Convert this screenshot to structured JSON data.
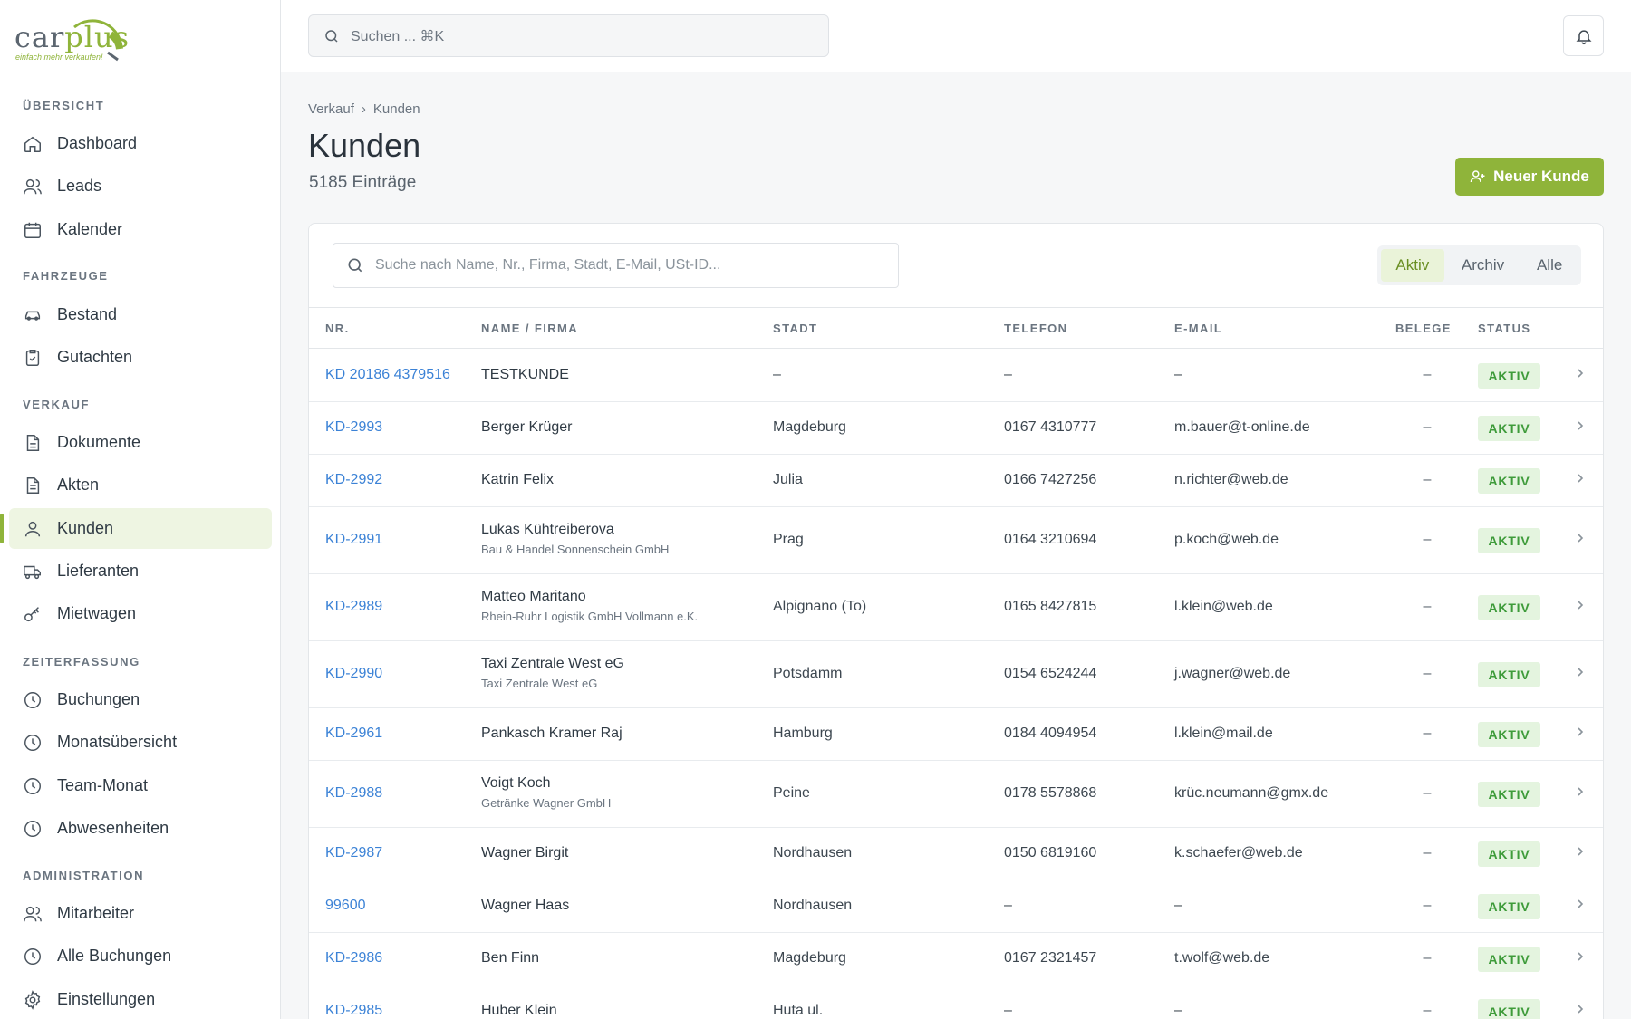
{
  "brand": {
    "name_a": "car",
    "name_b": "plus",
    "tagline": "einfach mehr verkaufen!"
  },
  "topbar": {
    "search_placeholder": "Suchen ... ⌘K"
  },
  "sidebar": {
    "sections": {
      "overview": "ÜBERSICHT",
      "vehicles": "FAHRZEUGE",
      "sales": "VERKAUF",
      "time": "ZEITERFASSUNG",
      "admin": "ADMINISTRATION"
    },
    "items": {
      "dashboard": "Dashboard",
      "leads": "Leads",
      "kalender": "Kalender",
      "bestand": "Bestand",
      "gutachten": "Gutachten",
      "dokumente": "Dokumente",
      "akten": "Akten",
      "kunden": "Kunden",
      "lieferanten": "Lieferanten",
      "mietwagen": "Mietwagen",
      "buchungen": "Buchungen",
      "monatsuebersicht": "Monatsübersicht",
      "teammonat": "Team-Monat",
      "abwesenheiten": "Abwesenheiten",
      "mitarbeiter": "Mitarbeiter",
      "allebuchungen": "Alle Buchungen",
      "einstellungen": "Einstellungen"
    }
  },
  "breadcrumb": {
    "parent": "Verkauf",
    "sep": "›",
    "current": "Kunden"
  },
  "page": {
    "title": "Kunden",
    "count": "5185 Einträge",
    "new_button": "Neuer Kunde"
  },
  "filter": {
    "placeholder": "Suche nach Name, Nr., Firma, Stadt, E-Mail, USt-ID...",
    "tabs": [
      "Aktiv",
      "Archiv",
      "Alle"
    ]
  },
  "table": {
    "headers": {
      "nr": "NR.",
      "name": "NAME / FIRMA",
      "city": "STADT",
      "tel": "TELEFON",
      "mail": "E-MAIL",
      "belege": "BELEGE",
      "status": "STATUS"
    },
    "rows": [
      {
        "nr": "KD 20186 4379516",
        "name": "TESTKUNDE",
        "company": "",
        "city": "–",
        "tel": "–",
        "mail": "–",
        "belege": "–",
        "status": "AKTIV"
      },
      {
        "nr": "KD-2993",
        "name": "Berger Krüger",
        "company": "",
        "city": "Magdeburg",
        "tel": "0167 4310777",
        "mail": "m.bauer@t-online.de",
        "belege": "–",
        "status": "AKTIV"
      },
      {
        "nr": "KD-2992",
        "name": "Katrin Felix",
        "company": "",
        "city": "Julia",
        "tel": "0166 7427256",
        "mail": "n.richter@web.de",
        "belege": "–",
        "status": "AKTIV"
      },
      {
        "nr": "KD-2991",
        "name": "Lukas Kühtreiberova",
        "company": "Bau & Handel Sonnenschein GmbH",
        "city": "Prag",
        "tel": "0164 3210694",
        "mail": "p.koch@web.de",
        "belege": "–",
        "status": "AKTIV"
      },
      {
        "nr": "KD-2989",
        "name": "Matteo Maritano",
        "company": "Rhein-Ruhr Logistik GmbH Vollmann e.K.",
        "city": "Alpignano (To)",
        "tel": "0165 8427815",
        "mail": "l.klein@web.de",
        "belege": "–",
        "status": "AKTIV"
      },
      {
        "nr": "KD-2990",
        "name": "Taxi Zentrale West eG",
        "company": "Taxi Zentrale West eG",
        "city": "Potsdamm",
        "tel": "0154 6524244",
        "mail": "j.wagner@web.de",
        "belege": "–",
        "status": "AKTIV"
      },
      {
        "nr": "KD-2961",
        "name": "Pankasch Kramer Raj",
        "company": "",
        "city": "Hamburg",
        "tel": "0184 4094954",
        "mail": "l.klein@mail.de",
        "belege": "–",
        "status": "AKTIV"
      },
      {
        "nr": "KD-2988",
        "name": "Voigt Koch",
        "company": "Getränke Wagner GmbH",
        "city": "Peine",
        "tel": "0178 5578868",
        "mail": "krüc.neumann@gmx.de",
        "belege": "–",
        "status": "AKTIV"
      },
      {
        "nr": "KD-2987",
        "name": "Wagner Birgit",
        "company": "",
        "city": "Nordhausen",
        "tel": "0150 6819160",
        "mail": "k.schaefer@web.de",
        "belege": "–",
        "status": "AKTIV"
      },
      {
        "nr": "99600",
        "name": "Wagner Haas",
        "company": "",
        "city": "Nordhausen",
        "tel": "–",
        "mail": "–",
        "belege": "–",
        "status": "AKTIV"
      },
      {
        "nr": "KD-2986",
        "name": "Ben Finn",
        "company": "",
        "city": "Magdeburg",
        "tel": "0167 2321457",
        "mail": "t.wolf@web.de",
        "belege": "–",
        "status": "AKTIV"
      },
      {
        "nr": "KD-2985",
        "name": "Huber Klein",
        "company": "",
        "city": "Huta ul.",
        "tel": "–",
        "mail": "–",
        "belege": "–",
        "status": "AKTIV"
      }
    ]
  }
}
